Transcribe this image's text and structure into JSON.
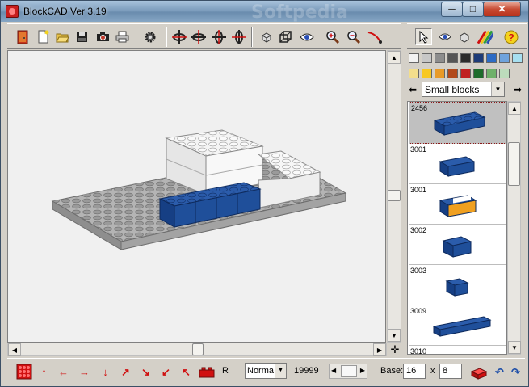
{
  "window": {
    "title": "BlockCAD Ver 3.19",
    "watermark": "Softpedia",
    "min_glyph": "─",
    "max_glyph": "□",
    "close_glyph": "✕"
  },
  "toolbar_right": {
    "help_glyph": "?"
  },
  "parts": {
    "category": "Small blocks",
    "items": [
      {
        "id": "2456"
      },
      {
        "id": "3001"
      },
      {
        "id": "3001"
      },
      {
        "id": "3002"
      },
      {
        "id": "3003"
      },
      {
        "id": "3009"
      },
      {
        "id": "3010"
      }
    ]
  },
  "palette": {
    "colors": [
      "#f2f2f2",
      "#c7c7c7",
      "#8d8d8d",
      "#555555",
      "#2b2b2b",
      "#1e3c78",
      "#2d6bc4",
      "#6fa3dc",
      "#a6dff0",
      "#f3de8c",
      "#f7c823",
      "#e89a28",
      "#b24a1c",
      "#c02121",
      "#1e6b2c",
      "#6fb06a",
      "#bcdcbc"
    ],
    "accent_red": "#d01010",
    "selected_brick": "#1f4f9a"
  },
  "status": {
    "render_mode": "Norma",
    "counter": "19999",
    "base_label": "Base:",
    "base_width": "16",
    "times": "x",
    "base_depth": "8",
    "rotate_label": "R"
  }
}
